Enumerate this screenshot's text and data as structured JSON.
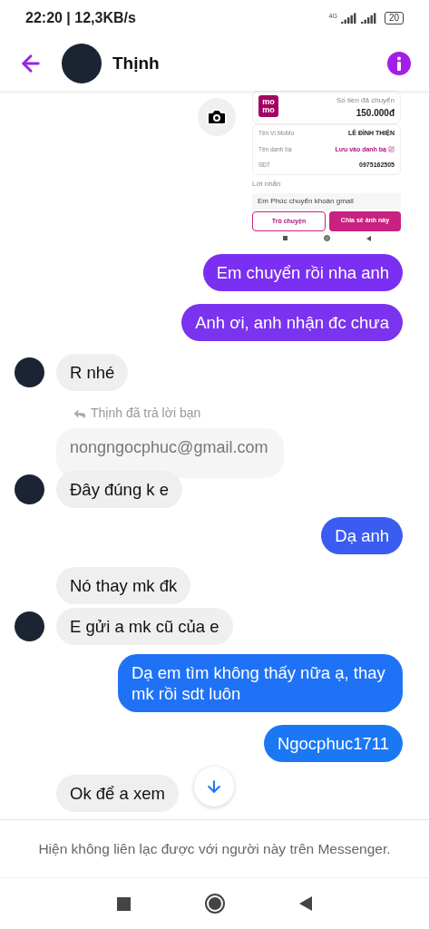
{
  "status_bar": {
    "time": "22:20 | 12,3KB/s",
    "network": "4G",
    "battery": "20"
  },
  "header": {
    "name": "Thịnh"
  },
  "shared_image": {
    "logo": [
      "mo",
      "mo"
    ],
    "amount_label": "Số tiền đã chuyển",
    "amount": "150.000đ",
    "rows": [
      {
        "label": "Tên Ví MoMo",
        "value": "LÊ ĐÌNH THIỆN",
        "kind": "plain"
      },
      {
        "label": "Tên danh bạ",
        "value": "Lưu vào danh bạ",
        "kind": "link"
      },
      {
        "label": "SĐT",
        "value": "0975162505",
        "kind": "plain"
      }
    ],
    "message_label": "Lời nhắn",
    "message": "Em Phúc chuyển khoản gmail",
    "buttons": [
      {
        "label": "Trò chuyện",
        "kind": "outline"
      },
      {
        "label": "Chia sẻ ảnh này",
        "kind": "filled"
      }
    ]
  },
  "messages": [
    {
      "kind": "sent",
      "text": "Em chuyển rồi nha anh",
      "color": "#7b2ff2"
    },
    {
      "kind": "sent",
      "text": "Anh ơi, anh nhận đc chưa",
      "color": "#7a33ee"
    },
    {
      "kind": "received",
      "text": "R nhé",
      "avatar": true
    },
    {
      "kind": "reply_note",
      "text": "Thịnh đã trả lời bạn"
    },
    {
      "kind": "quoted",
      "text": "nongngocphuc@gmail.com"
    },
    {
      "kind": "received",
      "text": "Đây đúng k e",
      "avatar": true
    },
    {
      "kind": "sent",
      "text": "Dạ anh",
      "color": "#3b5cf0"
    },
    {
      "kind": "received",
      "text": "Nó thay mk đk",
      "avatar": false
    },
    {
      "kind": "received",
      "text": "E gửi a mk cũ của e",
      "avatar": true
    },
    {
      "kind": "sent",
      "text": "Dạ em tìm không thấy nữa ạ, thay mk rồi sdt luôn",
      "color": "#1f72f5"
    },
    {
      "kind": "sent",
      "text": "Ngocphuc1711",
      "color": "#1a78f5"
    },
    {
      "kind": "received",
      "text": "Ok để a xem",
      "avatar": false
    }
  ],
  "footer": {
    "notice": "Hiện không liên lạc được với người này trên Messenger."
  }
}
